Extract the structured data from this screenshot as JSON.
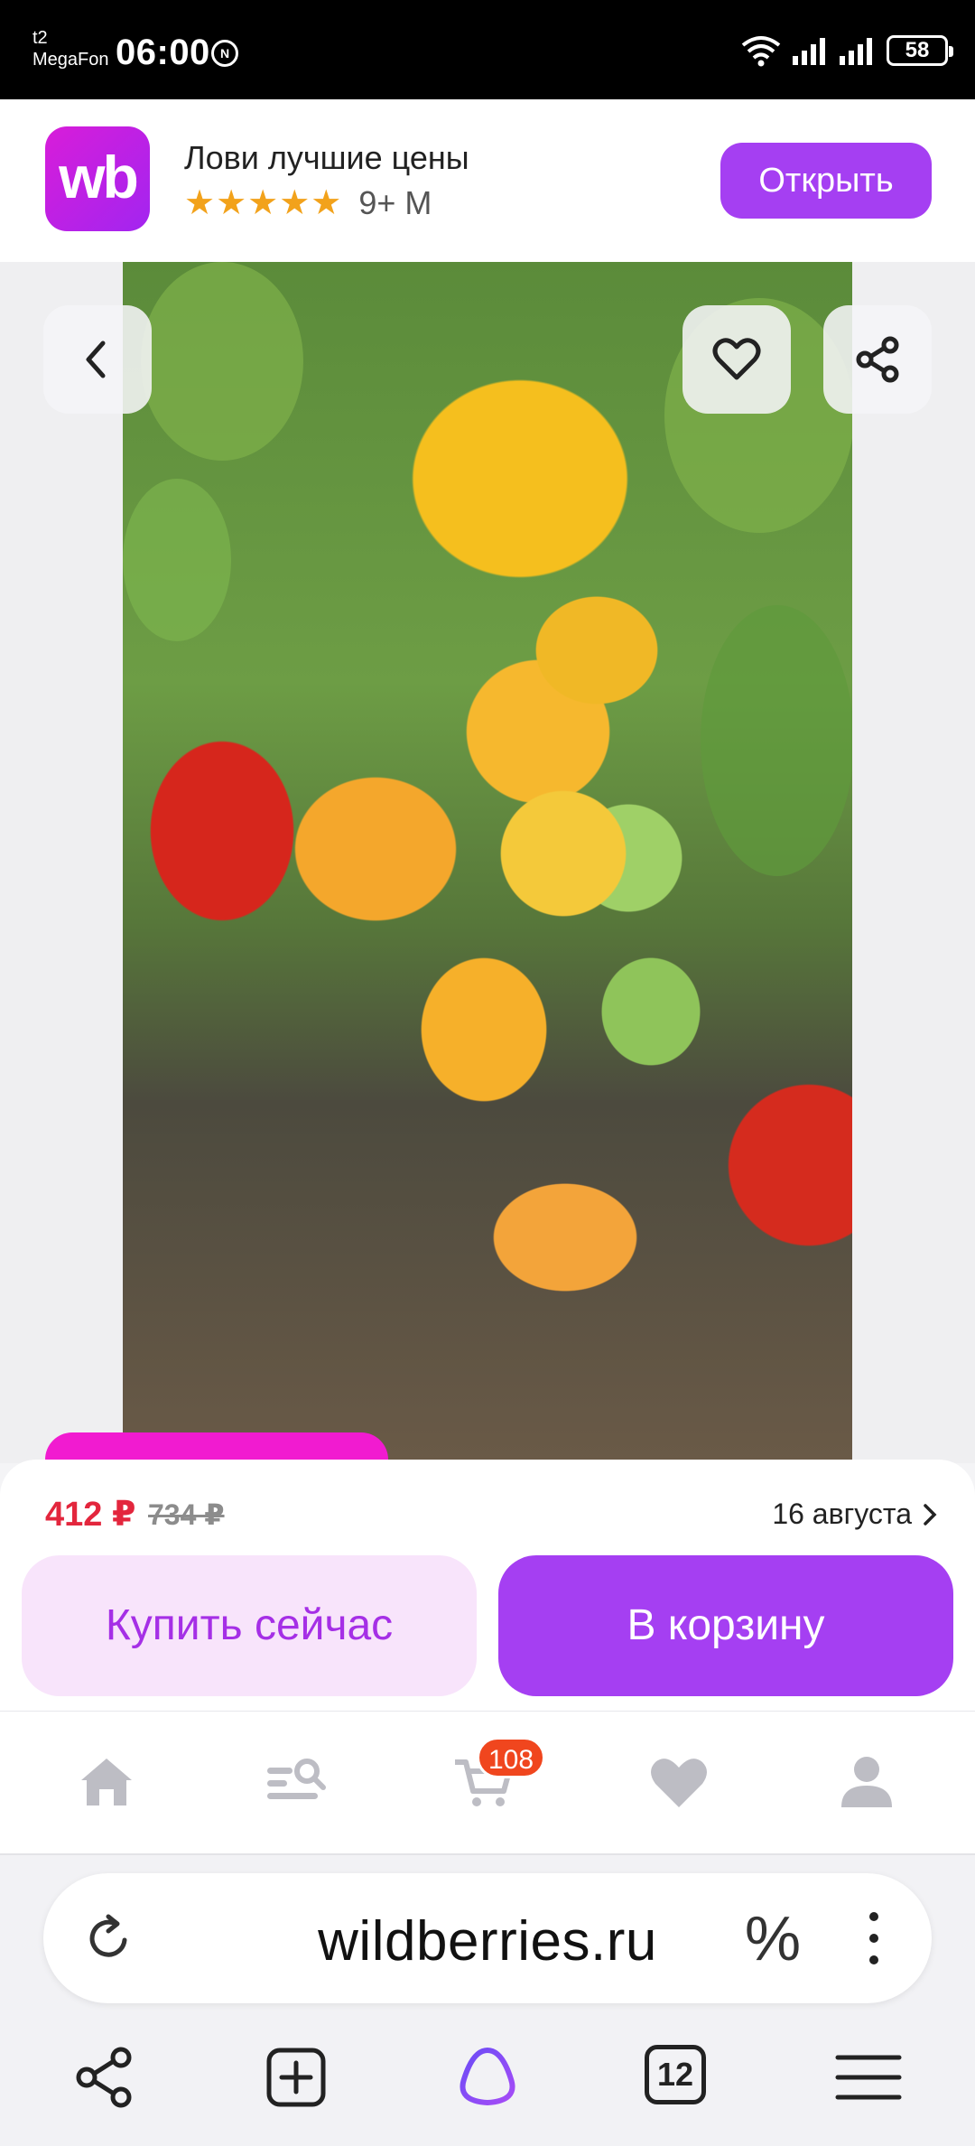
{
  "status_bar": {
    "carrier_line1": "t2",
    "carrier_line2": "MegaFon",
    "time": "06:00",
    "battery": "58",
    "icons": [
      "nfc-icon",
      "wifi-icon",
      "signal-icon",
      "signal-icon-2",
      "battery-icon"
    ]
  },
  "app_banner": {
    "logo": "wb",
    "title": "Лови лучшие цены",
    "stars": "★★★★★",
    "rating_count": "9+ M",
    "open_label": "Открыть",
    "accent": "#a53ff2"
  },
  "gallery": {
    "icons": [
      "chevron-left-icon",
      "heart-icon",
      "share-icon"
    ]
  },
  "buy_sheet": {
    "price": "412 ₽",
    "old_price": "734 ₽",
    "delivery": "16 августа",
    "buy_now_label": "Купить сейчас",
    "add_to_cart_label": "В корзину",
    "price_color": "#e3263d"
  },
  "app_nav": {
    "items": [
      "home-icon",
      "catalog-search-icon",
      "cart-icon",
      "favorites-icon",
      "profile-icon"
    ],
    "cart_badge": "108"
  },
  "browser": {
    "url": "wildberries.ru",
    "tabs_count": "12",
    "icons": [
      "reload-icon",
      "percent-icon",
      "more-icon",
      "share-icon",
      "new-tab-icon",
      "alice-icon",
      "tabs-icon",
      "menu-icon"
    ]
  }
}
